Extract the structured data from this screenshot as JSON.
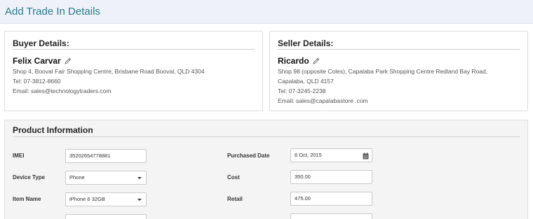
{
  "page": {
    "title": "Add Trade In Details"
  },
  "buyer": {
    "heading": "Buyer Details:",
    "name": "Felix Carvar",
    "address": "Shop 4, Booval Fair Shopping Centre, Brisbane Road Booval, QLD 4304",
    "tel": "Tel: 07-3812-8660",
    "email": "Email: sales@technologytraders.com"
  },
  "seller": {
    "heading": "Seller Details:",
    "name": "Ricardo",
    "address_line1": "Shop 98 (opposite Coles), Capalaba Park Shopping Centre Redland Bay Road,",
    "address_line2": "Capalaba, QLD 4157",
    "tel": "Tel: 07-3245-2238",
    "email": "Email: sales@capalabastore .com"
  },
  "product": {
    "heading": "Product Information",
    "imei": {
      "label": "IMEI",
      "value": "35202654778881"
    },
    "device_type": {
      "label": "Device Type",
      "value": "Phone"
    },
    "item_name": {
      "label": "Item Name",
      "value": "iPhone 6 32GB"
    },
    "purchased_date": {
      "label": "Purchased Date",
      "value": "6 Oct, 2015"
    },
    "cost": {
      "label": "Cost",
      "value": "350.00"
    },
    "retail": {
      "label": "Retail",
      "value": "475.00"
    }
  },
  "icons": {
    "edit": "pencil-icon",
    "calendar": "calendar-icon",
    "dropdown": "caret-down-icon"
  }
}
